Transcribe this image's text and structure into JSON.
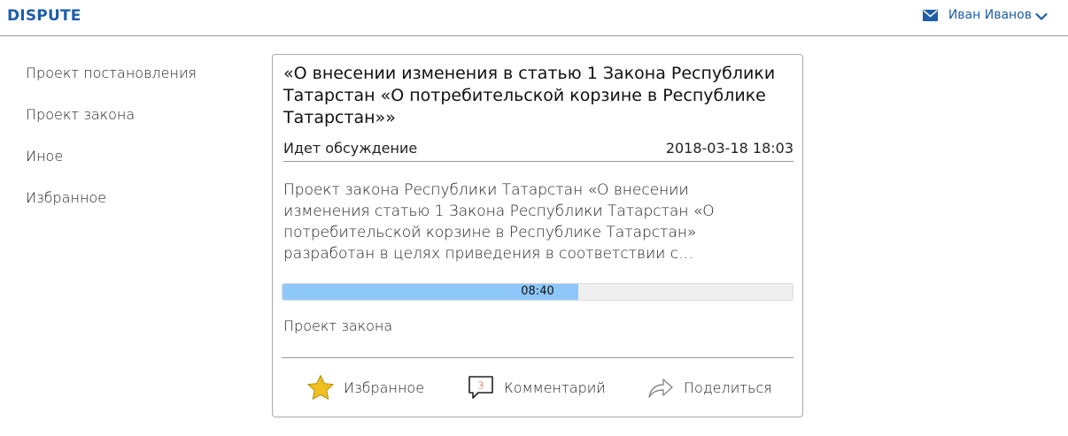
{
  "header": {
    "brand": "DISPUTE",
    "user_name": "Иван Иванов",
    "icons": {
      "mail": "mail-icon",
      "dropdown": "chevron-down-icon"
    },
    "accent_color": "#1f5ea8"
  },
  "sidebar": {
    "items": [
      {
        "label": "Проект постановления"
      },
      {
        "label": "Проект закона"
      },
      {
        "label": "Иное"
      },
      {
        "label": "Избранное"
      }
    ]
  },
  "card": {
    "title": "«О внесении изменения в статью 1 Закона Республики Татарстан «О потребительской корзине в Республике Татарстан»»",
    "status": "Идет обсуждение",
    "datetime": "2018-03-18 18:03",
    "description": "Проект закона Республики Татарстан «О внесении изменения статью 1 Закона Республики Татарстан «О потребительской корзине в Республике Татарстан» разработан в целях приведения в соответствии с…",
    "progress": {
      "label": "08:40",
      "fraction": 0.58,
      "color": "#8ec8fb"
    },
    "category": "Проект закона",
    "actions": {
      "favorite": {
        "label": "Избранное",
        "icon": "star-icon",
        "color": "#f0c020"
      },
      "comments": {
        "label": "Комментарий",
        "icon": "comment-icon",
        "count": "3",
        "count_color": "#d9302a"
      },
      "share": {
        "label": "Поделиться",
        "icon": "share-icon"
      }
    }
  }
}
